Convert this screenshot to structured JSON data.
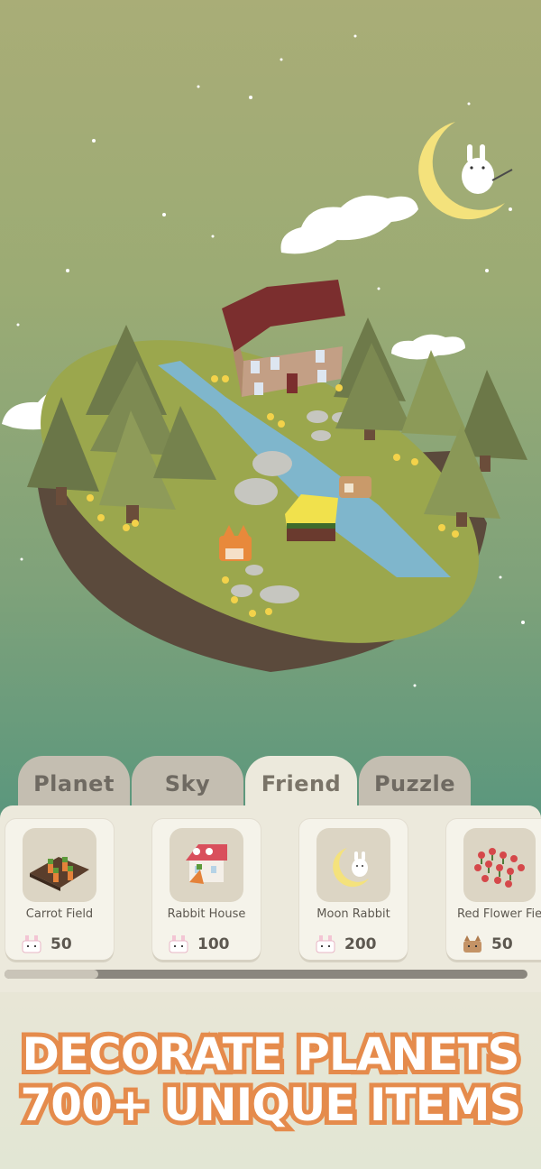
{
  "tabs": [
    {
      "label": "Planet",
      "active": false
    },
    {
      "label": "Sky",
      "active": false
    },
    {
      "label": "Friend",
      "active": true
    },
    {
      "label": "Puzzle",
      "active": false
    }
  ],
  "items": [
    {
      "name": "Carrot Field",
      "price": "50",
      "currency_icon": "rabbit-icon"
    },
    {
      "name": "Rabbit House",
      "price": "100",
      "currency_icon": "rabbit-icon"
    },
    {
      "name": "Moon Rabbit",
      "price": "200",
      "currency_icon": "rabbit-icon"
    },
    {
      "name": "Red Flower Field",
      "price": "50",
      "currency_icon": "cat-icon"
    }
  ],
  "scroll_progress": 0.18,
  "headline": {
    "line1": "DECORATE PLANETS",
    "line2": "700+ UNIQUE ITEMS",
    "text_color": "#ffffff",
    "outline_color": "#e58b4c"
  }
}
